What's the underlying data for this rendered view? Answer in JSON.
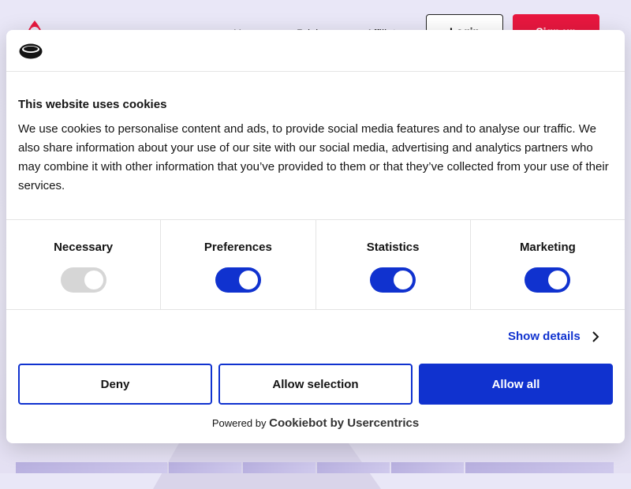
{
  "site": {
    "nav": [
      "Home",
      "Pricing",
      "Affiliate"
    ],
    "login_label": "Login",
    "signup_label": "Sign up",
    "colors": {
      "signup": "#e8173f"
    }
  },
  "cookie_dialog": {
    "logo_icon": "cookiebot-logo-icon",
    "title": "This website uses cookies",
    "body": "We use cookies to personalise content and ads, to provide social media features and to analyse our traffic. We also share information about your use of our site with our social media, advertising and analytics partners who may combine it with other information that you’ve provided to them or that they’ve collected from your use of their services.",
    "categories": [
      {
        "label": "Necessary",
        "enabled": true,
        "locked": true
      },
      {
        "label": "Preferences",
        "enabled": true,
        "locked": false
      },
      {
        "label": "Statistics",
        "enabled": true,
        "locked": false
      },
      {
        "label": "Marketing",
        "enabled": true,
        "locked": false
      }
    ],
    "show_details_label": "Show details",
    "buttons": {
      "deny": "Deny",
      "allow_selection": "Allow selection",
      "allow_all": "Allow all"
    },
    "powered_by_prefix": "Powered by",
    "powered_by_brand": "Cookiebot by Usercentrics",
    "colors": {
      "accent": "#1032cf",
      "toggle_disabled": "#d6d6d6"
    }
  }
}
